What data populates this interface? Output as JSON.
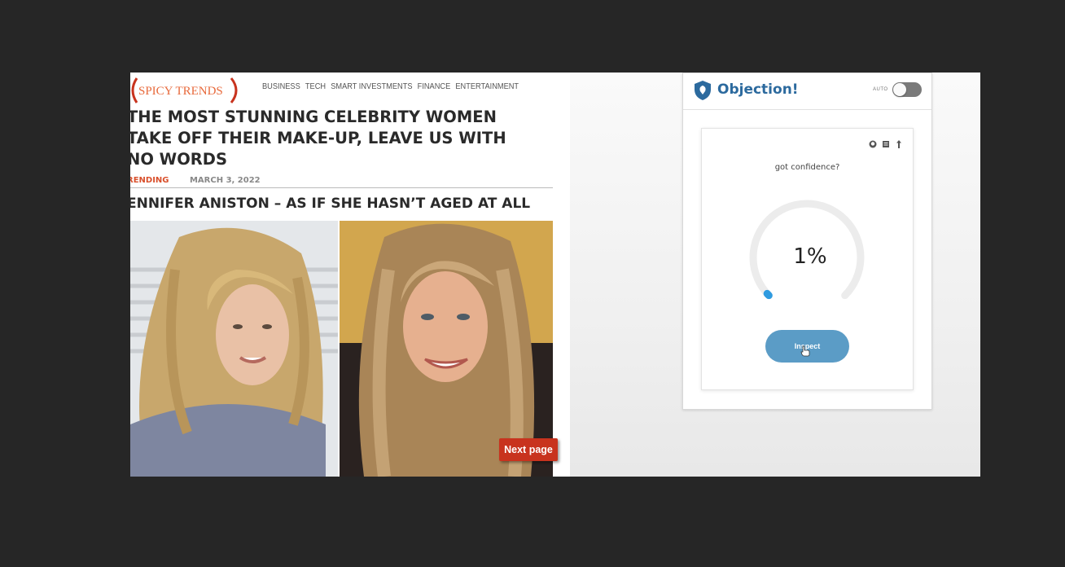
{
  "article": {
    "logo_text": "SPICY TRENDS",
    "nav": [
      "BUSINESS",
      "TECH",
      "SMART INVESTMENTS",
      "FINANCE",
      "ENTERTAINMENT"
    ],
    "headline_lines": [
      "THE MOST STUNNING CELEBRITY WOMEN",
      "TAKE OFF THEIR MAKE-UP, LEAVE US WITH",
      "NO WORDS"
    ],
    "category": "RENDING",
    "date": "MARCH 3, 2022",
    "subheading": "ENNIFER ANISTON – AS IF SHE HASN’T AGED AT ALL",
    "next_button": "Next page"
  },
  "extension": {
    "title": "Objection!",
    "auto_label": "AUTO",
    "auto_enabled": false,
    "card_icons": [
      "github-icon",
      "document-icon",
      "pin-icon"
    ],
    "question": "got confidence?",
    "confidence_text": "1%",
    "confidence_value": 0.01,
    "inspect_button": "Inspect",
    "colors": {
      "brand": "#2c6a9e",
      "gauge_progress": "#2f9be0",
      "gauge_track": "#ececec",
      "button": "#5b9cc6",
      "next_page": "#c8331e",
      "accent_orange": "#e86a3c"
    }
  }
}
